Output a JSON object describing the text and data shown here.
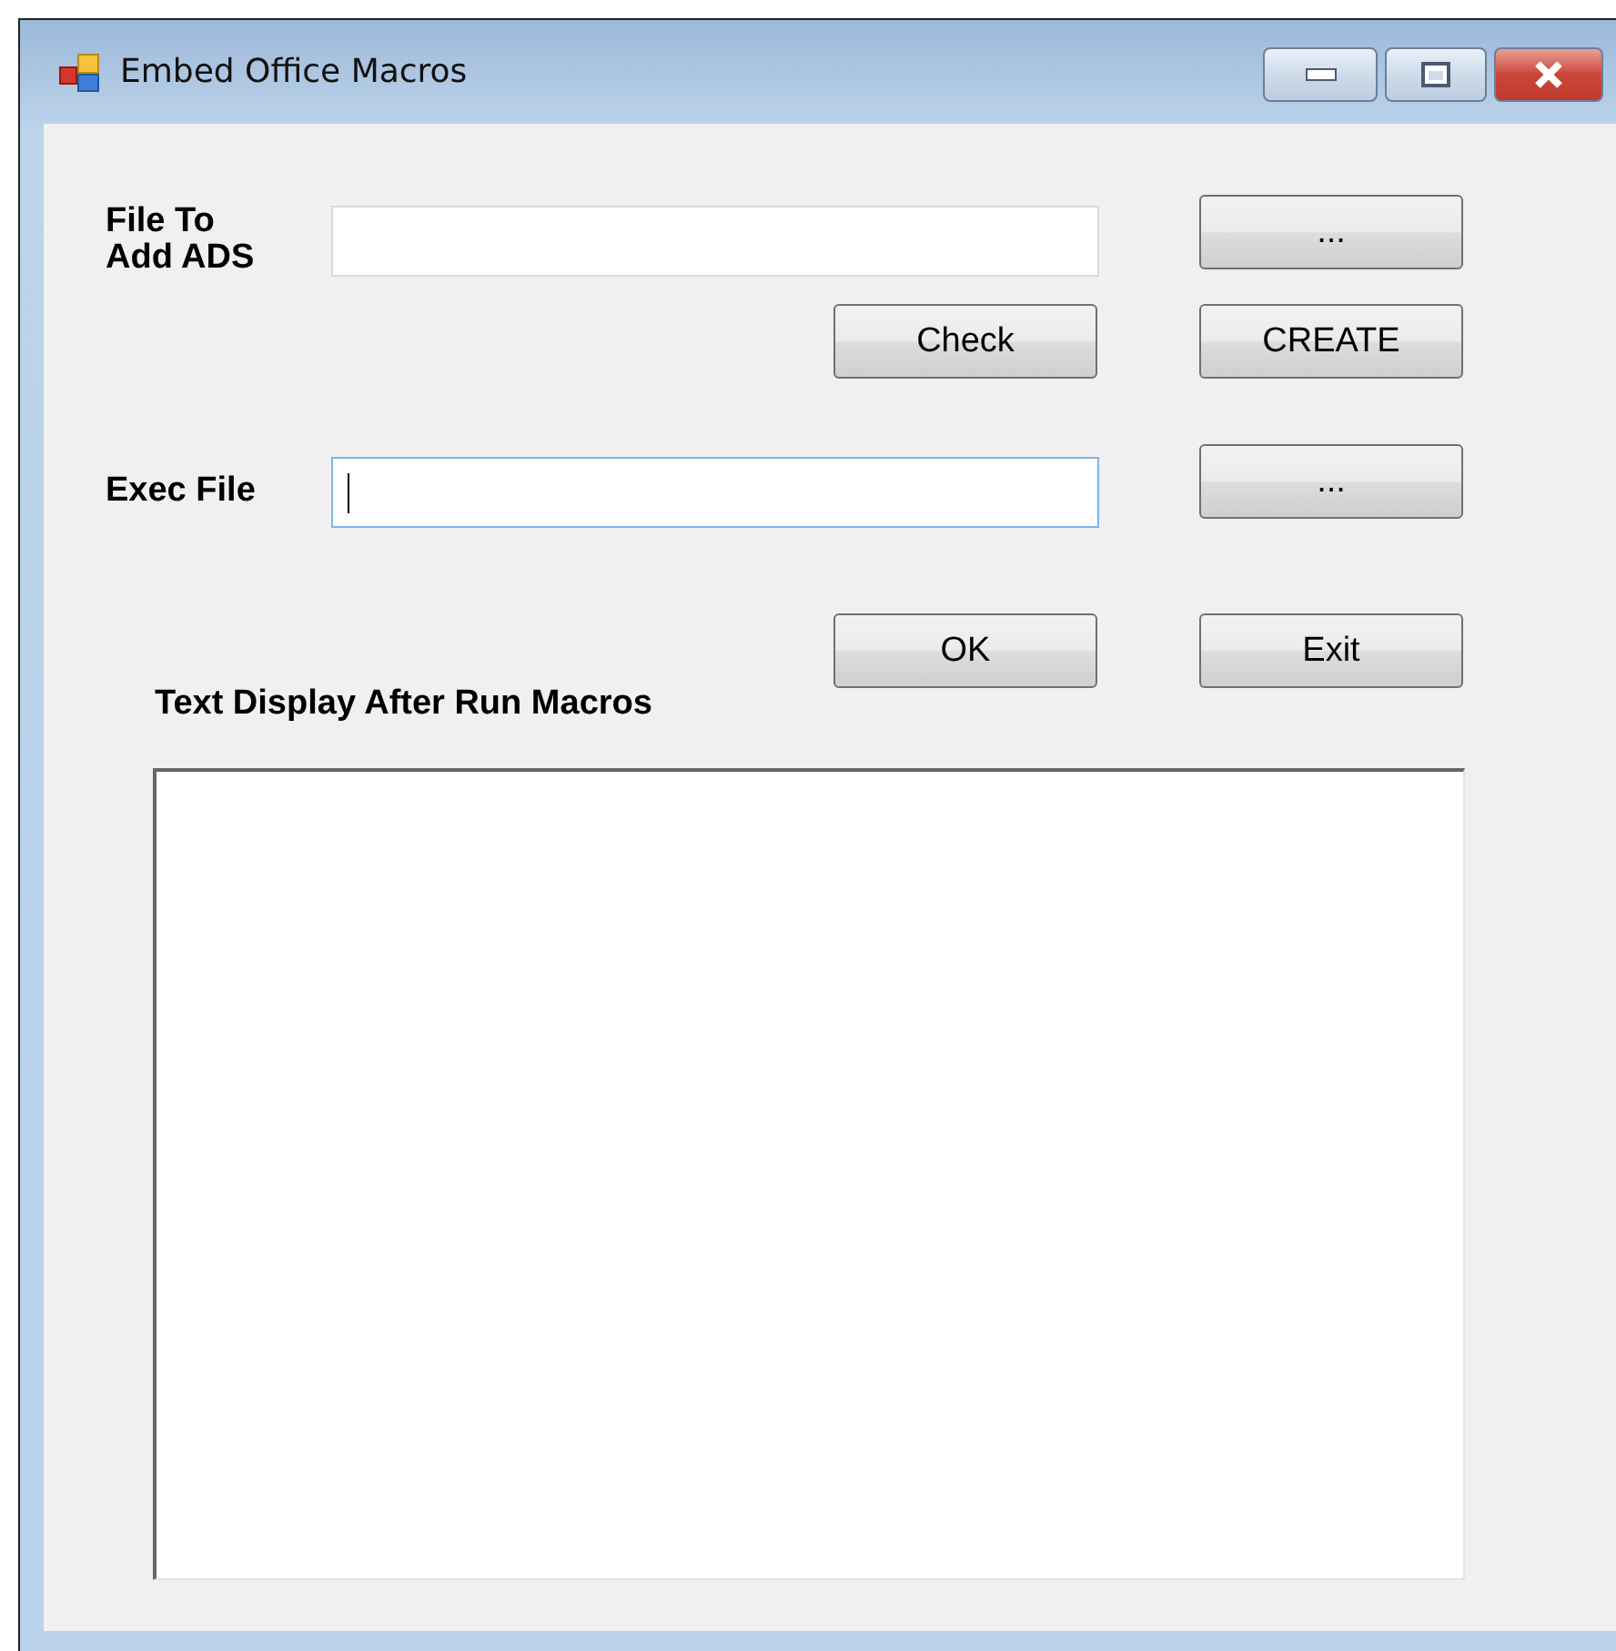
{
  "window": {
    "title": "Embed Office Macros"
  },
  "file_row": {
    "label": "File To\nAdd ADS",
    "focused": false,
    "browse_button": "..."
  },
  "actions_1": [
    "Check",
    "CREATE"
  ],
  "exec_row": {
    "label": "Exec File",
    "focused": true,
    "browse_button": "..."
  },
  "actions_2": [
    "OK",
    "Exit"
  ],
  "output": {
    "label": "Text Display After Run Macros"
  }
}
